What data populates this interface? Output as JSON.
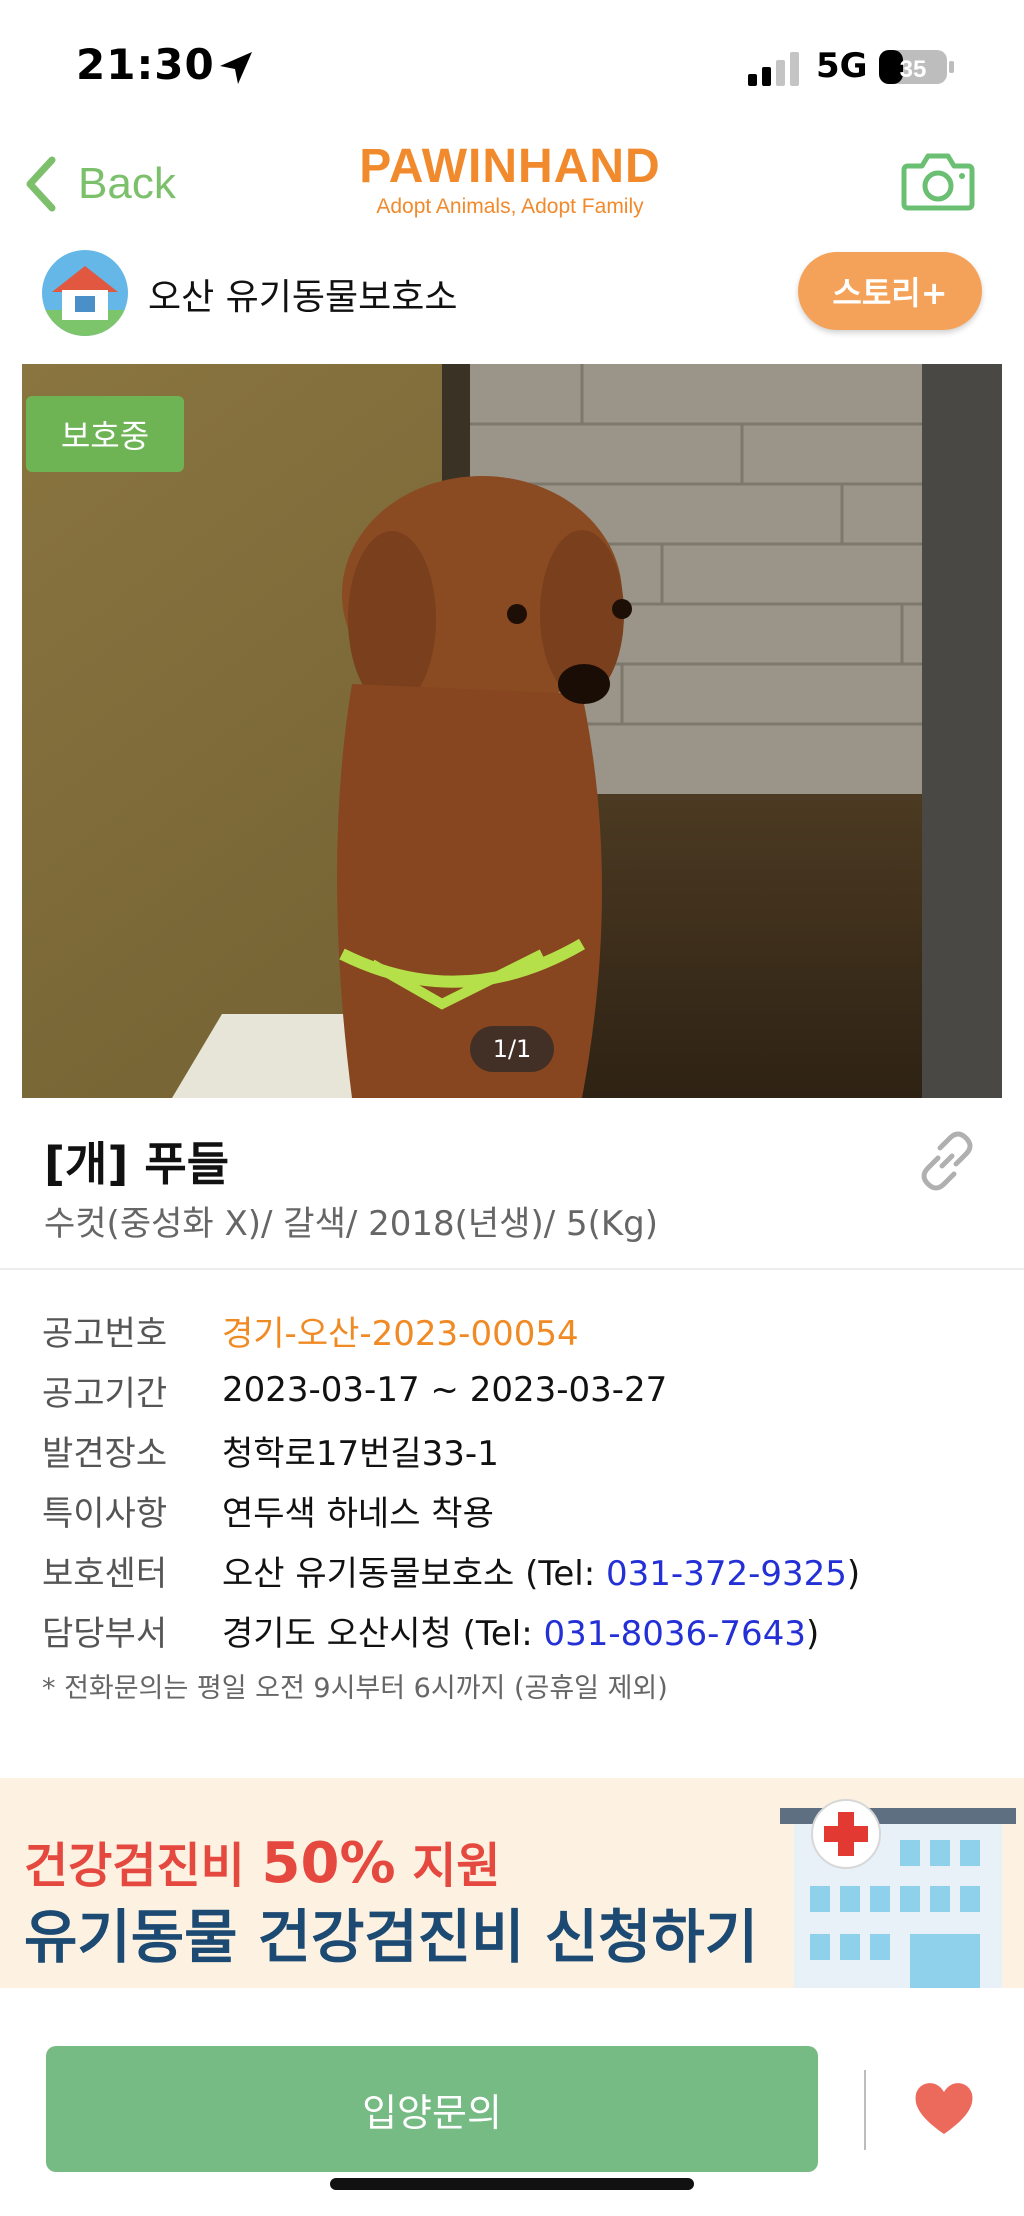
{
  "status_bar": {
    "time": "21:30",
    "network": "5G",
    "battery": "35"
  },
  "nav": {
    "back_label": "Back",
    "brand_name": "PAWINHAND",
    "brand_tagline": "Adopt Animals, Adopt Family"
  },
  "shelter": {
    "name": "오산 유기동물보호소",
    "story_button": "스토리+"
  },
  "photo": {
    "status_badge": "보호중",
    "counter": "1/1"
  },
  "animal": {
    "title": "[개] 푸들",
    "subtitle": "수컷(중성화 X)/ 갈색/ 2018(년생)/ 5(Kg)"
  },
  "info": {
    "notice_no_label": "공고번호",
    "notice_no": "경기-오산-2023-00054",
    "period_label": "공고기간",
    "period": "2023-03-17 ~ 2023-03-27",
    "found_label": "발견장소",
    "found": "청학로17번길33-1",
    "special_label": "특이사항",
    "special": "연두색 하네스 착용",
    "center_label": "보호센터",
    "center_name": "오산 유기동물보호소 (Tel: ",
    "center_tel": "031-372-9325",
    "center_close": ")",
    "dept_label": "담당부서",
    "dept_name": "경기도 오산시청 (Tel: ",
    "dept_tel": "031-8036-7643",
    "dept_close": ")",
    "note": "* 전화문의는 평일 오전 9시부터 6시까지 (공휴일 제외)"
  },
  "banner": {
    "line1_a": "건강검진비 ",
    "line1_b": "50%",
    "line1_c": " 지원",
    "line2": "유기동물 건강검진비 신청하기"
  },
  "bottom": {
    "adopt_button": "입양문의"
  },
  "colors": {
    "accent_green": "#76ba84",
    "brand_orange": "#f18a2c",
    "tel_blue": "#2330d6",
    "heart_red": "#ec6a5c"
  }
}
